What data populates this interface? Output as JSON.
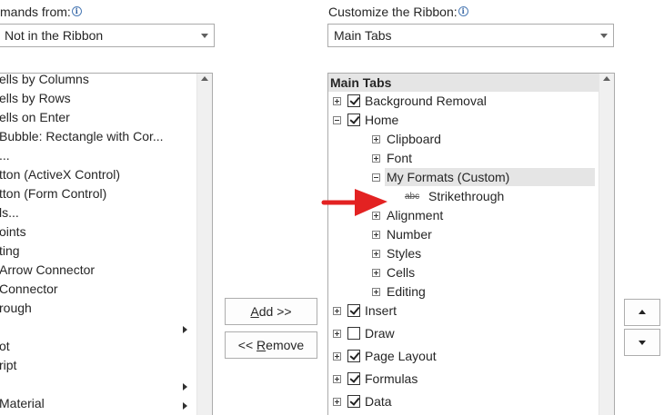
{
  "left": {
    "label": "mands from:",
    "combo_value": "Not in the Ribbon",
    "items": [
      {
        "label": "ells by Columns",
        "submenu": false
      },
      {
        "label": "ells by Rows",
        "submenu": false
      },
      {
        "label": "ells on Enter",
        "submenu": false
      },
      {
        "label": "Bubble: Rectangle with Cor...",
        "submenu": false
      },
      {
        "label": "...",
        "submenu": false
      },
      {
        "label": "tton (ActiveX Control)",
        "submenu": false
      },
      {
        "label": "tton (Form Control)",
        "submenu": false
      },
      {
        "label": "ls...",
        "submenu": false
      },
      {
        "label": "oints",
        "submenu": false
      },
      {
        "label": "ting",
        "submenu": false
      },
      {
        "label": " Arrow Connector",
        "submenu": false
      },
      {
        "label": " Connector",
        "submenu": false
      },
      {
        "label": "rough",
        "submenu": false
      },
      {
        "label": "",
        "submenu": true
      },
      {
        "label": "ot",
        "submenu": false
      },
      {
        "label": "ript",
        "submenu": false
      },
      {
        "label": "",
        "submenu": true
      },
      {
        "label": " Material",
        "submenu": true
      }
    ]
  },
  "buttons": {
    "add": "Add >>",
    "remove": "<< Remove"
  },
  "right": {
    "label": "Customize the Ribbon:",
    "combo_value": "Main Tabs",
    "list_header": "Main Tabs",
    "tree": [
      {
        "label": "Background Removal",
        "level": 0,
        "expander": "plus",
        "checkbox": true,
        "checked": true
      },
      {
        "label": "Home",
        "level": 0,
        "expander": "minus",
        "checkbox": true,
        "checked": true
      },
      {
        "label": "Clipboard",
        "level": 1,
        "expander": "plus",
        "checkbox": false
      },
      {
        "label": "Font",
        "level": 1,
        "expander": "plus",
        "checkbox": false
      },
      {
        "label": "My Formats (Custom)",
        "level": 1,
        "expander": "minus",
        "checkbox": false,
        "selected": true
      },
      {
        "label": "Strikethrough",
        "level": 2,
        "expander": "none",
        "checkbox": false,
        "icon": "abc"
      },
      {
        "label": "Alignment",
        "level": 1,
        "expander": "plus",
        "checkbox": false
      },
      {
        "label": "Number",
        "level": 1,
        "expander": "plus",
        "checkbox": false
      },
      {
        "label": "Styles",
        "level": 1,
        "expander": "plus",
        "checkbox": false
      },
      {
        "label": "Cells",
        "level": 1,
        "expander": "plus",
        "checkbox": false
      },
      {
        "label": "Editing",
        "level": 1,
        "expander": "plus",
        "checkbox": false
      },
      {
        "label": "Insert",
        "level": 0,
        "expander": "plus",
        "checkbox": true,
        "checked": true
      },
      {
        "label": "Draw",
        "level": 0,
        "expander": "plus",
        "checkbox": true,
        "checked": false
      },
      {
        "label": "Page Layout",
        "level": 0,
        "expander": "plus",
        "checkbox": true,
        "checked": true
      },
      {
        "label": "Formulas",
        "level": 0,
        "expander": "plus",
        "checkbox": true,
        "checked": true
      },
      {
        "label": "Data",
        "level": 0,
        "expander": "plus",
        "checkbox": true,
        "checked": true
      }
    ]
  },
  "annotation": {
    "arrow_color": "#e32222"
  },
  "icons": {
    "info": "info-icon",
    "move_up": "move-up-arrow-icon",
    "move_down": "move-down-arrow-icon",
    "strikethrough": "strikethrough-abc-icon"
  }
}
